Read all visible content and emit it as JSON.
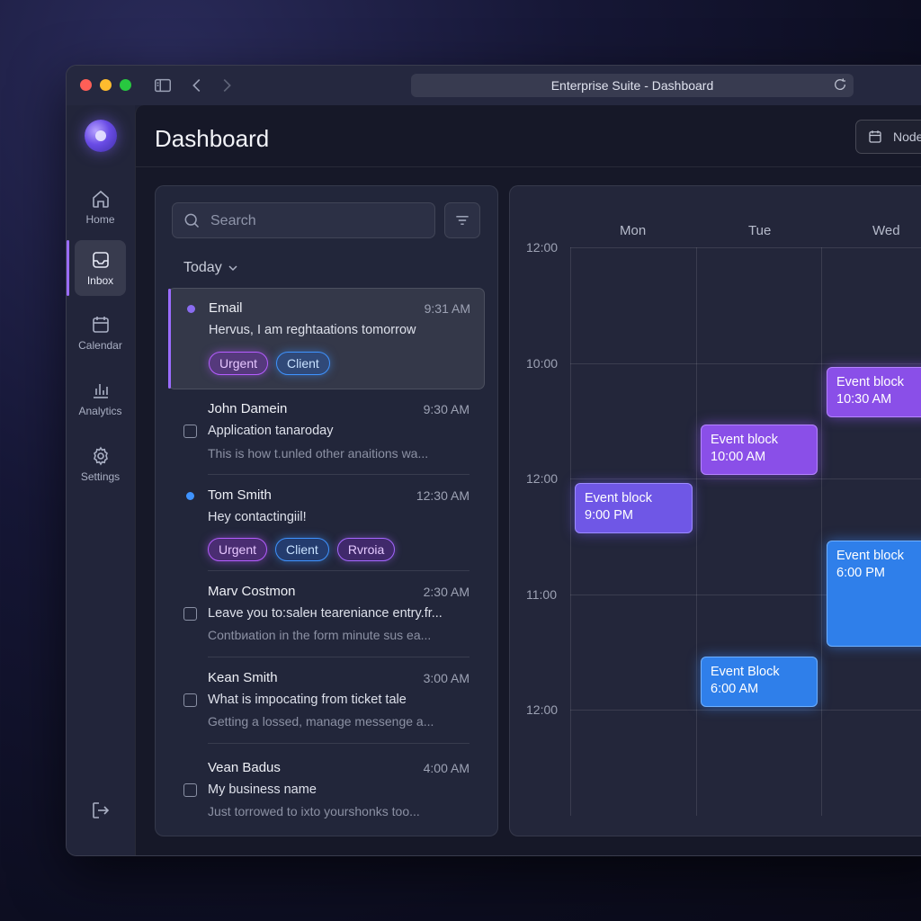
{
  "window": {
    "title": "Enterprise Suite - Dashboard"
  },
  "sidebar": {
    "items": [
      {
        "label": "Home",
        "icon": "home-icon"
      },
      {
        "label": "Inbox",
        "icon": "inbox-icon",
        "active": true
      },
      {
        "label": "Calendar",
        "icon": "calendar-icon"
      },
      {
        "label": "Analytics",
        "icon": "analytics-icon"
      },
      {
        "label": "Settings",
        "icon": "gear-icon"
      }
    ],
    "logout_icon": "logout-icon"
  },
  "header": {
    "title": "Dashboard",
    "node_button": "Node"
  },
  "inbox": {
    "search_placeholder": "Search",
    "group_label": "Today",
    "messages": [
      {
        "from": "Email",
        "time": "9:31 AM",
        "subject": "Hervus, I am reghtaations tomorrow",
        "preview": "",
        "tags": [
          "Urgent",
          "Client"
        ],
        "unread_color": "#8a6cf0",
        "selected": true
      },
      {
        "from": "John Damein",
        "time": "9:30 AM",
        "subject": "Application tanaroday",
        "preview": "This is how t.unled other anaitions wa...",
        "tags": []
      },
      {
        "from": "Tom Smith",
        "time": "12:30 AM",
        "subject": "Hey contactingiil!",
        "preview": "",
        "tags": [
          "Urgent",
          "Client",
          "Rvroia"
        ],
        "unread_color": "#3f93ff"
      },
      {
        "from": "Marv Costmon",
        "time": "2:30 AM",
        "subject": "Leave you to:saleн teareniance entry.fr...",
        "preview": "Contbиation in the form minute sus ea...",
        "tags": []
      },
      {
        "from": "Kean Smith",
        "time": "3:00 AM",
        "subject": "What is impocating from ticket tale",
        "preview": "Getting a lossed, manage messenge a...",
        "tags": []
      },
      {
        "from": "Vean Badus",
        "time": "4:00 AM",
        "subject": "My business name",
        "preview": "Just torrowed to ixto yourshonks too...",
        "tags": []
      }
    ]
  },
  "calendar": {
    "days": [
      "Mon",
      "Tue",
      "Wed"
    ],
    "hours": [
      "12:00",
      "10:00",
      "12:00",
      "11:00",
      "12:00"
    ],
    "events": [
      {
        "title": "Event block",
        "time": "10:30 AM",
        "day": "Wed",
        "color": "purple"
      },
      {
        "title": "Event block",
        "time": "10:00 AM",
        "day": "Tue",
        "color": "purple"
      },
      {
        "title": "Event block",
        "time": "9:00 PM",
        "day": "Mon",
        "color": "violet"
      },
      {
        "title": "Event block",
        "time": "6:00 PM",
        "day": "Wed",
        "color": "blue"
      },
      {
        "title": "Event Block",
        "time": "6:00 AM",
        "day": "Tue",
        "color": "blue"
      }
    ]
  },
  "colors": {
    "accent": "#9a6cff",
    "urgent": "#b55dff",
    "client": "#3f93ff",
    "event_purple": "#8a4fe8",
    "event_blue": "#2f7fea"
  }
}
